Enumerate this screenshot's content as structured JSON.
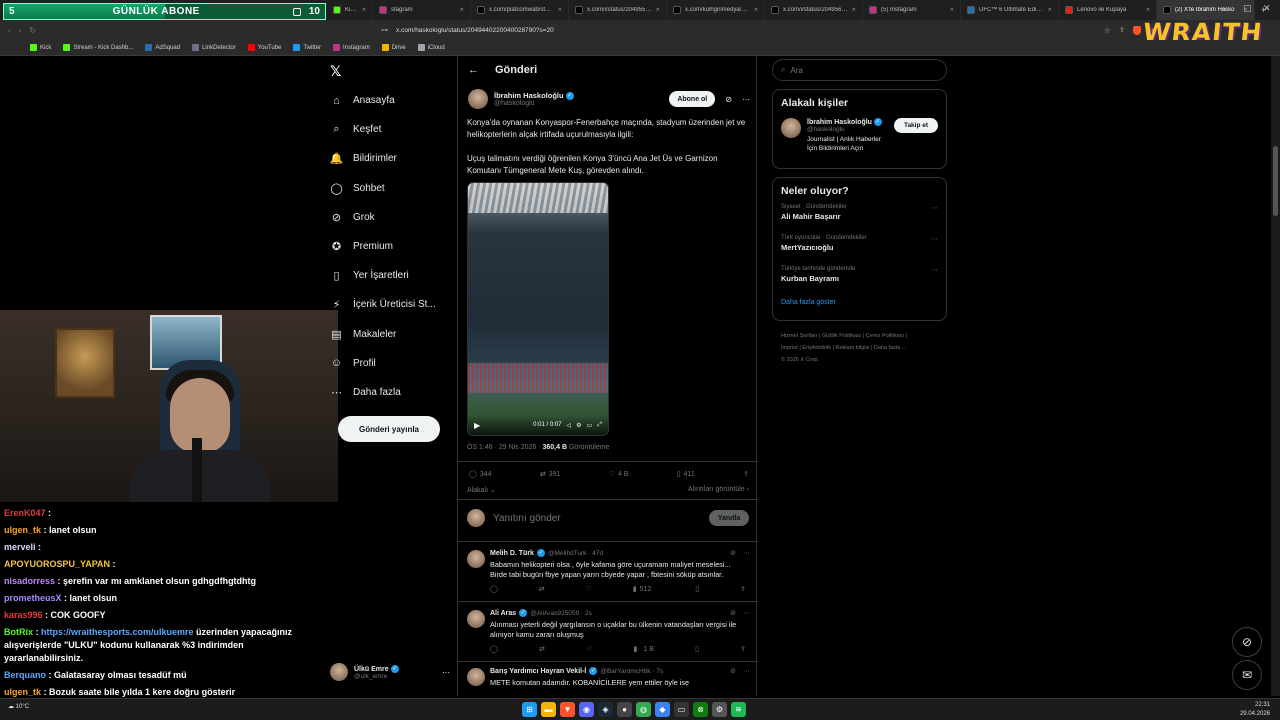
{
  "browser": {
    "tabs": [
      {
        "label": "KickSight Link Detector",
        "fav_color": "#53fc18"
      },
      {
        "label": "stagram",
        "fav_color": "#c13584"
      },
      {
        "label": "x.com/platcomwab/status",
        "fav_color": "#000000"
      },
      {
        "label": "x.com/i/status/2049556336",
        "fav_color": "#000000"
      },
      {
        "label": "x.com/kulhginmedya/statu",
        "fav_color": "#000000"
      },
      {
        "label": "x.com/i/status/2049561183",
        "fav_color": "#000000"
      },
      {
        "label": "(5) Instagram",
        "fav_color": "#c13584"
      },
      {
        "label": "UFC™ 6 Ultimate Edition",
        "fav_color": "#2b6cb0"
      },
      {
        "label": "Lenovo ile Kupaya",
        "fav_color": "#e2231a"
      },
      {
        "label": "(2) X'te İbrahim Hasko",
        "fav_color": "#000000",
        "active": true
      }
    ],
    "new_tab": "+",
    "url": "x.com/haskologlu/status/2049440220040028790?s=20",
    "bookmarks": [
      {
        "label": "Kick",
        "color": "#53fc18"
      },
      {
        "label": "Stream - Kick Dashb...",
        "color": "#53fc18"
      },
      {
        "label": "AdSquad",
        "color": "#2b6cb0"
      },
      {
        "label": "LinkDetector",
        "color": "#6b7280"
      },
      {
        "label": "YouTube",
        "color": "#ff0000"
      },
      {
        "label": "Twitter",
        "color": "#1d9bf0"
      },
      {
        "label": "Instagram",
        "color": "#c13584"
      },
      {
        "label": "Drive",
        "color": "#f4b400"
      },
      {
        "label": "iCloud",
        "color": "#9ca3af"
      }
    ]
  },
  "overlay": {
    "sub_goal_current": "5",
    "sub_goal_label": "GÜNLÜK ABONE",
    "sub_goal_target": "10",
    "sub_goal_progress": 0.5,
    "brand_logo": "WRAITH"
  },
  "chat": [
    {
      "user": "ErenK047",
      "color": "#e03c3c",
      "msg": ""
    },
    {
      "user": "ulgen_tk",
      "color": "#f5a623",
      "msg": "lanet olsun"
    },
    {
      "user": "merveli",
      "color": "#d8d8ff",
      "msg": ""
    },
    {
      "user": "APOYUOROSPU_YAPAN",
      "color": "#f5c542",
      "msg": ""
    },
    {
      "user": "nisadorress",
      "color": "#c084fc",
      "msg": "şerefin var mı amklanet olsun gdhgdfhgtdhtg"
    },
    {
      "user": "prometheusX",
      "color": "#a78bfa",
      "msg": "lanet olsun"
    },
    {
      "user": "karas996",
      "color": "#e03c3c",
      "msg": "COK GOOFY"
    },
    {
      "user": "BotRix",
      "color": "#53fc18",
      "msg": "https://wraithesports.com/ulkuemre üzerinden yapacağınız alışverişlerde \"ULKU\" kodunu kullanarak %3 indirimden yararlanabilirsiniz.",
      "link": "https://wraithesports.com/ulkuemre"
    },
    {
      "user": "Berquano",
      "color": "#60a5fa",
      "msg": "Galatasaray olması tesadüf mü"
    },
    {
      "user": "ulgen_tk",
      "color": "#f5a623",
      "msg": "Bozuk saate bile yılda 1 kere doğru gösterir"
    }
  ],
  "nav": {
    "items": [
      {
        "label": "Anasayfa",
        "icon": "home-icon",
        "glyph": "⌂"
      },
      {
        "label": "Keşfet",
        "icon": "search-icon",
        "glyph": "⌕"
      },
      {
        "label": "Bildirimler",
        "icon": "bell-icon",
        "glyph": "🔔"
      },
      {
        "label": "Sohbet",
        "icon": "chat-icon",
        "glyph": "◯"
      },
      {
        "label": "Grok",
        "icon": "grok-icon",
        "glyph": "⊘"
      },
      {
        "label": "Premium",
        "icon": "premium-icon",
        "glyph": "✪"
      },
      {
        "label": "Yer İşaretleri",
        "icon": "bookmark-icon",
        "glyph": "▯"
      },
      {
        "label": "İçerik Üreticisi St...",
        "icon": "creator-icon",
        "glyph": "⚡"
      },
      {
        "label": "Makaleler",
        "icon": "articles-icon",
        "glyph": "▤"
      },
      {
        "label": "Profil",
        "icon": "profile-icon",
        "glyph": "☺"
      },
      {
        "label": "Daha fazla",
        "icon": "more-icon",
        "glyph": "⋯"
      }
    ],
    "post_button": "Gönderi yayınla",
    "account_name": "Ülkü Emre",
    "account_handle": "@ulk_emre"
  },
  "post": {
    "header_title": "Gönderi",
    "author_name": "İbrahim Haskoloğlu",
    "author_handle": "@haskologlu",
    "subscribe_label": "Abone ol",
    "paragraph1": "Konya'da oynanan Konyaspor-Fenerbahçe maçında, stadyum üzerinden jet ve helikopterlerin alçak irtifada uçurulmasıyla ilgili:",
    "paragraph2": "Uçuş talimatını verdiği öğrenilen Konya 3'üncü Ana Jet Üs ve Garnizon Komutanı Tümgeneral Mete Kuş, görevden alındı.",
    "video_time": "0:01 / 0:07",
    "timestamp": "ÖS 1:46 · 29 Nis 2026 ·",
    "views_count": "360,4 B",
    "views_label": "Görüntüleme",
    "stats": {
      "replies": "344",
      "reposts": "391",
      "likes": "4 B",
      "bookmarks": "411"
    },
    "relevant_label": "Alakalı",
    "quotes_label": "Alıntıları görüntüle",
    "reply_placeholder": "Yanıtını gönder",
    "reply_button": "Yanıtla"
  },
  "replies": [
    {
      "name": "Melih D. Türk",
      "handle": "@MelihdTurk · 47d",
      "text": "Babamın helikopteri olsa , öyle kafama göre uçuramam maliyet meselesi... Birde tabi bugün fbye yapan yarın cbyede yapar , fbtesini söküp atsınlar.",
      "views": "512",
      "likes": ""
    },
    {
      "name": "Ali Aras",
      "handle": "@AliAras925059 · 2s",
      "text": "Alınması yeterli değil yargılansın o uçaklar bu ülkenin vatandaşları vergisi ile alınıyor kamu zararı oluşmuş",
      "views": "",
      "likes": "1 B"
    },
    {
      "name": "Barış Yardımcı Hayran Vekil-İ",
      "handle": "@BarYardmcHbk · 7s",
      "text": "METE komutan adamdır. KOBANİCİLERE yem ettiler öyle ise",
      "views": "",
      "likes": ""
    }
  ],
  "sidebar": {
    "search_placeholder": "Ara",
    "relevant_title": "Alakalı kişiler",
    "relevant_name": "İbrahim Haskoloğlu",
    "relevant_handle": "@haskologlu",
    "relevant_bio": "Journalist | Anlık Haberler İçin Bildirimleri Açın",
    "follow_label": "Takip et",
    "trends_title": "Neler oluyor?",
    "trends": [
      {
        "context": "Siyaset · Gündemdekiler",
        "name": "Ali Mahir Başarır"
      },
      {
        "context": "Türk oyuncular · Gündemdekiler",
        "name": "MertYazıcıoğlu"
      },
      {
        "context": "Türkiye tarihinde gündemde",
        "name": "Kurban Bayramı"
      }
    ],
    "show_more": "Daha fazla göster",
    "footer_line1": "Hizmet Şartları | Gizlilik Politikası | Çerez Politikası |",
    "footer_line2": "İmprint | Erişilebilirlik | Reklam bilgisi | Daha fazla ...",
    "footer_line3": "© 2026 X Corp."
  },
  "taskbar": {
    "weather": "10°C",
    "time": "22:31",
    "date": "29.04.2026"
  }
}
